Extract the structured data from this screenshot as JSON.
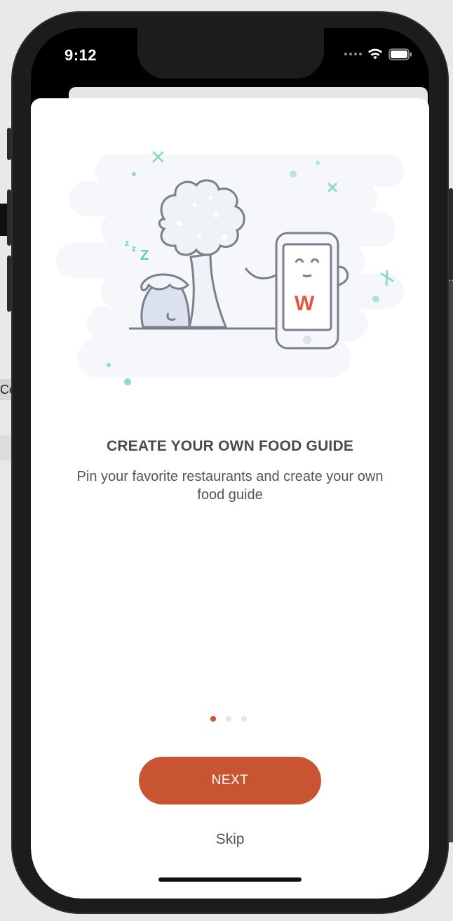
{
  "status_bar": {
    "time": "9:12"
  },
  "background": {
    "partial_tab_label": "Ce"
  },
  "onboarding": {
    "title": "CREATE YOUR OWN FOOD GUIDE",
    "description": "Pin your favorite restaurants and create your own food guide",
    "illustration": {
      "phone_logo_letter": "W",
      "sleep_letters": "z z"
    },
    "pagination": {
      "current_page": 1,
      "total_pages": 3
    },
    "next_label": "NEXT",
    "skip_label": "Skip"
  },
  "colors": {
    "accent": "#c85431",
    "title_text": "#4a4a4a",
    "body_text": "#555555",
    "inactive_dot": "#e6e6e6",
    "sparkle": "#8fdcc3"
  },
  "icons": {
    "wifi": "wifi-icon",
    "battery": "battery-icon",
    "signal": "signal-dots-icon"
  }
}
